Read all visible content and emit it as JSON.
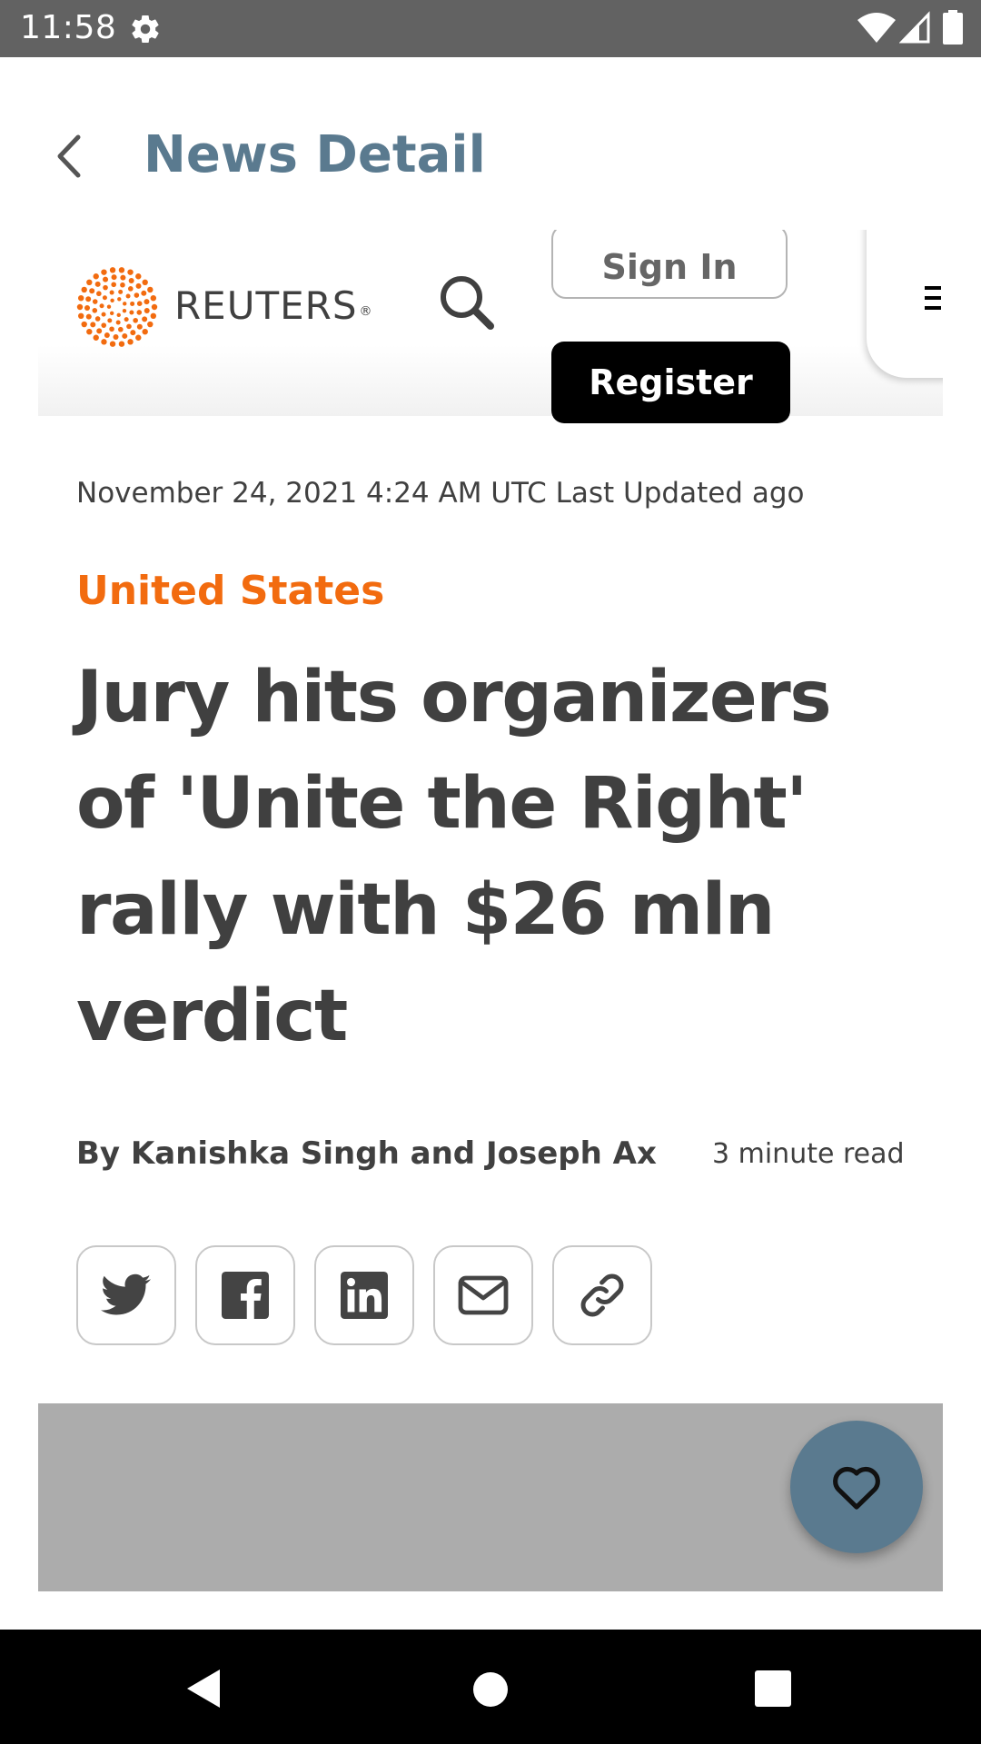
{
  "status_bar": {
    "time": "11:58",
    "icons": [
      "settings-icon",
      "wifi-icon",
      "signal-icon",
      "battery-icon"
    ]
  },
  "app_bar": {
    "title": "News Detail",
    "back_icon": "back-arrow-icon",
    "title_color": "#5a7a8f"
  },
  "site_header": {
    "brand": "REUTERS",
    "brand_mark": "®",
    "brand_color": "#f26b0f",
    "sign_in_label": "Sign In",
    "register_label": "Register",
    "icons": [
      "reuters-logo-icon",
      "search-icon",
      "menu-icon"
    ]
  },
  "article": {
    "date": "November 24, 2021 4:24 AM UTC Last Updated ago",
    "section": "United States",
    "section_color": "#f26b0f",
    "headline": "Jury hits organizers of 'Unite the Right' rally with $26 mln verdict",
    "byline": "By Kanishka Singh and Joseph Ax",
    "read_time": "3 minute read",
    "share_buttons": [
      "twitter-icon",
      "facebook-icon",
      "linkedin-icon",
      "email-icon",
      "link-icon"
    ]
  },
  "fab": {
    "icon": "heart-icon",
    "color": "#5a7a8f"
  },
  "nav_bar": {
    "icons": [
      "nav-back-icon",
      "nav-home-icon",
      "nav-recents-icon"
    ]
  }
}
